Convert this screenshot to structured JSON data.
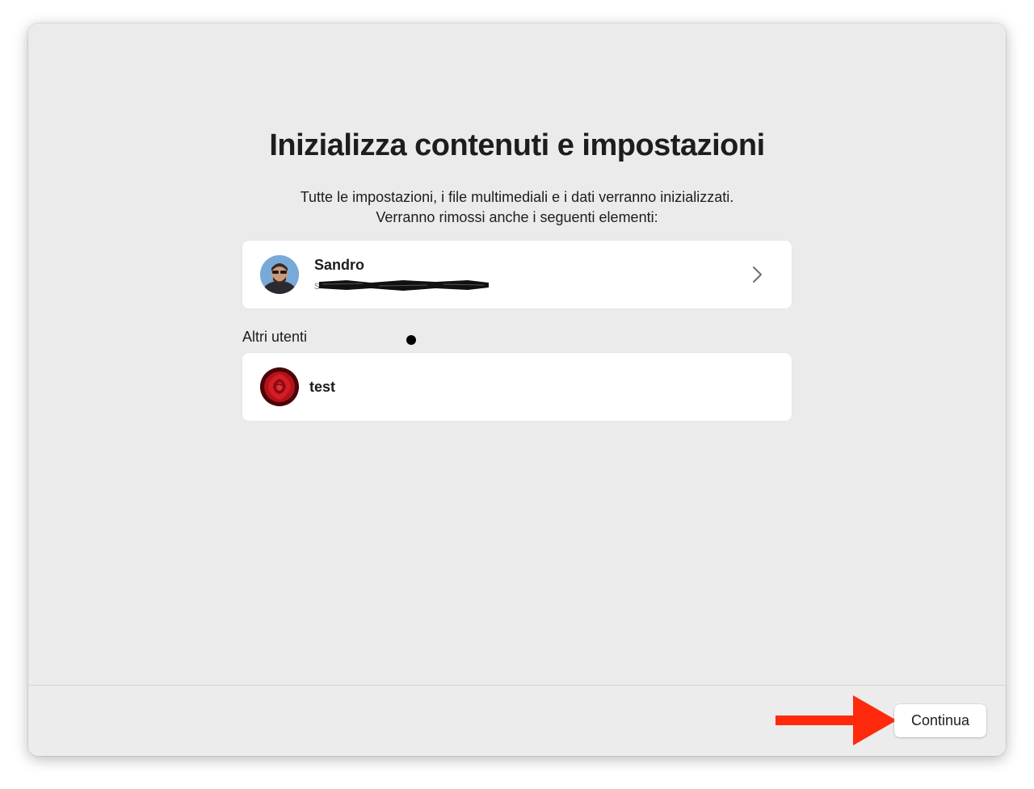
{
  "dialog": {
    "title": "Inizializza contenuti e impostazioni",
    "subtitle_line1": "Tutte le impostazioni, i file multimediali e i dati verranno inizializzati.",
    "subtitle_line2": "Verranno rimossi anche i seguenti elementi:"
  },
  "main_user": {
    "name": "Sandro",
    "avatar_icon": "user-photo-avatar",
    "chevron_icon": "chevron-right-icon"
  },
  "other_users": {
    "label": "Altri utenti",
    "items": [
      {
        "name": "test",
        "avatar_icon": "rose-avatar"
      }
    ]
  },
  "footer": {
    "continue_label": "Continua"
  },
  "annotation": {
    "arrow_color": "#ff2a0d"
  }
}
